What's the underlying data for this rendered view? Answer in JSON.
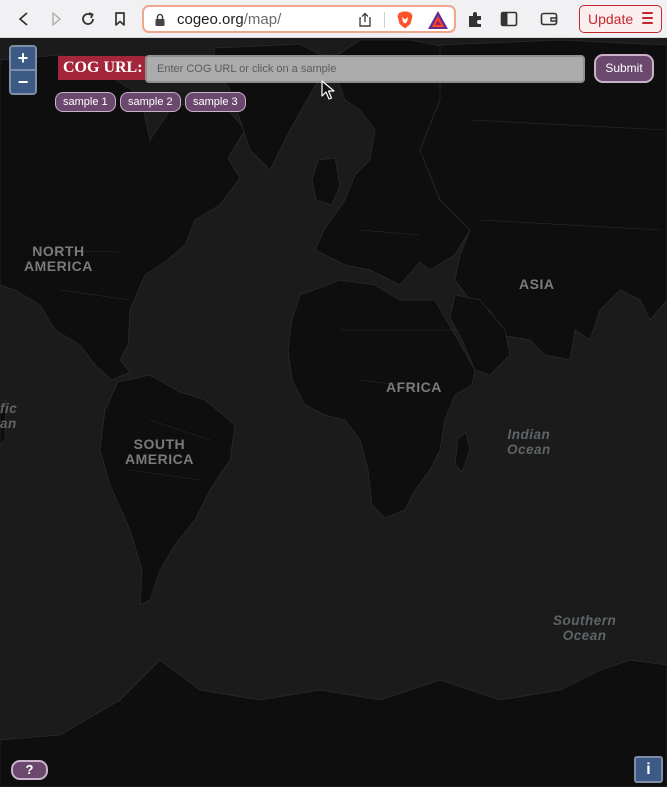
{
  "browser": {
    "url_domain": "cogeo.org",
    "url_path": "/map/",
    "update_label": "Update",
    "icons": [
      "back-icon",
      "forward-icon",
      "reload-icon",
      "bookmark-icon",
      "lock-icon",
      "share-icon",
      "brave-shields-icon",
      "brave-rewards-icon",
      "extensions-icon",
      "sidebar-icon",
      "wallet-icon",
      "menu-icon"
    ]
  },
  "app": {
    "zoom_in_label": "+",
    "zoom_out_label": "−",
    "cog_label": "COG URL:",
    "url_placeholder": "Enter COG URL or click on a sample",
    "submit_label": "Submit",
    "samples": [
      "sample 1",
      "sample 2",
      "sample 3"
    ],
    "help_label": "?",
    "info_label": "i"
  },
  "map": {
    "continents": {
      "north_america": "NORTH\nAMERICA",
      "south_america": "SOUTH\nAMERICA",
      "africa": "AFRICA",
      "asia": "ASIA"
    },
    "oceans": {
      "pacific": "fic\nan",
      "indian": "Indian\nOcean",
      "southern": "Southern\nOcean"
    }
  },
  "colors": {
    "land": "#0e0e0f",
    "water": "#1b1b1c",
    "accent_purple": "#6b496f",
    "label_red": "#a3263a",
    "control_blue": "#3d5a87"
  }
}
